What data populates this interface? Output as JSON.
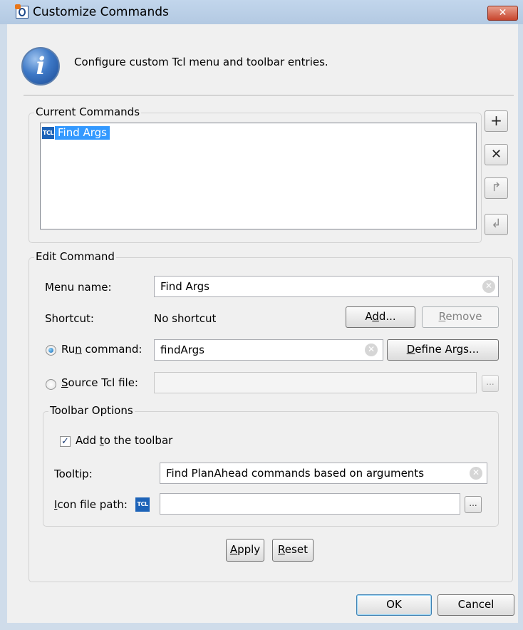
{
  "window": {
    "title": "Customize Commands",
    "close_glyph": "✕"
  },
  "header": {
    "text": "Configure custom Tcl menu and toolbar entries."
  },
  "current_commands": {
    "group_label": "Current Commands",
    "items": [
      {
        "icon_text": "TCL",
        "label": "Find Args",
        "selected": true
      }
    ],
    "buttons": {
      "add_glyph": "+",
      "remove_glyph": "✕",
      "up_glyph": "↱",
      "down_glyph": "↲"
    }
  },
  "edit_command": {
    "group_label": "Edit Command",
    "menu_name": {
      "label": "Menu name:",
      "value": "Find Args"
    },
    "shortcut": {
      "label": "Shortcut:",
      "value": "No shortcut",
      "add_pre": "A",
      "add_u": "d",
      "add_post": "d...",
      "remove_pre": "",
      "remove_u": "R",
      "remove_post": "emove"
    },
    "run_command": {
      "label_pre": "Ru",
      "label_u": "n",
      "label_post": " command:",
      "value": "findArgs",
      "checked": true,
      "define_pre": "",
      "define_u": "D",
      "define_post": "efine Args..."
    },
    "source_file": {
      "label_pre": "",
      "label_u": "S",
      "label_post": "ource Tcl file:",
      "value": "",
      "checked": false,
      "browse": "..."
    },
    "toolbar_options": {
      "group_label": "Toolbar Options",
      "add_to_toolbar": {
        "label_pre": "Add ",
        "label_u": "t",
        "label_post": "o the toolbar",
        "checked": true,
        "check_glyph": "✓"
      },
      "tooltip": {
        "label": "Tooltip:",
        "value": "Find PlanAhead commands based on arguments"
      },
      "icon_path": {
        "label_pre": "",
        "label_u": "I",
        "label_post": "con file path:",
        "icon_text": "TCL",
        "value": "",
        "browse": "..."
      }
    },
    "apply_pre": "",
    "apply_u": "A",
    "apply_post": "pply",
    "reset_pre": "",
    "reset_u": "R",
    "reset_post": "eset"
  },
  "footer": {
    "ok": "OK",
    "cancel": "Cancel"
  },
  "clear_glyph": "✕",
  "colors": {
    "selection": "#3399ff",
    "tcl_badge": "#1d63b8",
    "close_button": "#c8452d"
  }
}
